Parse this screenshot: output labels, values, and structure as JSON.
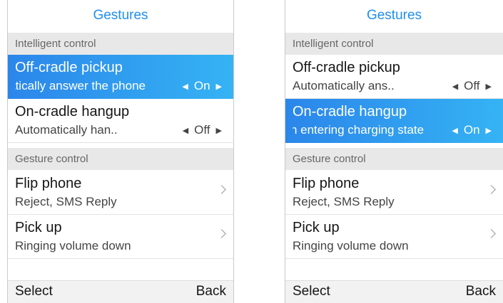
{
  "screens": [
    {
      "title": "Gestures",
      "section_intelligent": "Intelligent control",
      "section_gesture": "Gesture control",
      "items": [
        {
          "title": "Off-cradle pickup",
          "subtitle": "Automatically answer the phone",
          "value": "On"
        },
        {
          "title": "On-cradle hangup",
          "subtitle": "Automatically han..",
          "value": "Off"
        },
        {
          "title": "Flip phone",
          "subtitle": "Reject, SMS Reply"
        },
        {
          "title": "Pick up",
          "subtitle": "Ringing volume down"
        }
      ],
      "softkeys": {
        "left": "Select",
        "right": "Back"
      }
    },
    {
      "title": "Gestures",
      "section_intelligent": "Intelligent control",
      "section_gesture": "Gesture control",
      "items": [
        {
          "title": "Off-cradle pickup",
          "subtitle": "Automatically ans..",
          "value": "Off"
        },
        {
          "title": "On-cradle hangup",
          "subtitle": "When entering charging state",
          "value": "On"
        },
        {
          "title": "Flip phone",
          "subtitle": "Reject, SMS Reply"
        },
        {
          "title": "Pick up",
          "subtitle": "Ringing volume down"
        }
      ],
      "softkeys": {
        "left": "Select",
        "right": "Back"
      }
    }
  ],
  "icons": {
    "left_arrow": "◀",
    "right_arrow": "▶"
  },
  "colors": {
    "title": "#1f8ff0",
    "selected_start": "#2b86ea",
    "selected_end": "#35b3f4",
    "section_bg": "#e8e8e8"
  }
}
